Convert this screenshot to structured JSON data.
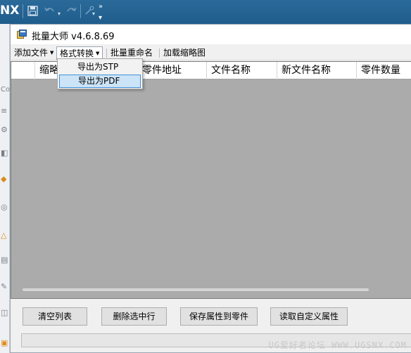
{
  "nx": {
    "logo": "NX",
    "toolbar_icons": [
      "save-icon",
      "undo-icon",
      "redo-icon",
      "customize-icon",
      "overflow-icon"
    ]
  },
  "window": {
    "title": "批量大师 v4.6.8.69"
  },
  "menu": {
    "add_file": "添加文件",
    "format_convert": "格式转换",
    "batch_rename": "批量重命名",
    "load_thumbnail": "加载缩略图"
  },
  "dropdown": {
    "items": [
      {
        "label": "导出为STP",
        "highlighted": false
      },
      {
        "label": "导出为PDF",
        "highlighted": true
      }
    ]
  },
  "grid": {
    "columns": [
      "缩略",
      "零件地址",
      "文件名称",
      "新文件名称",
      "零件数量"
    ]
  },
  "buttons": {
    "clear_list": "清空列表",
    "delete_selected": "删除选中行",
    "save_props": "保存属性到零件",
    "read_custom": "读取自定义属性"
  },
  "watermark": "UG爱好者论坛 WWW.UGSNX.COM",
  "colors": {
    "nx_bar": "#1f5d8c",
    "grid_bg": "#ababab",
    "highlight": "#cce4f7",
    "highlight_border": "#3e90d8"
  }
}
